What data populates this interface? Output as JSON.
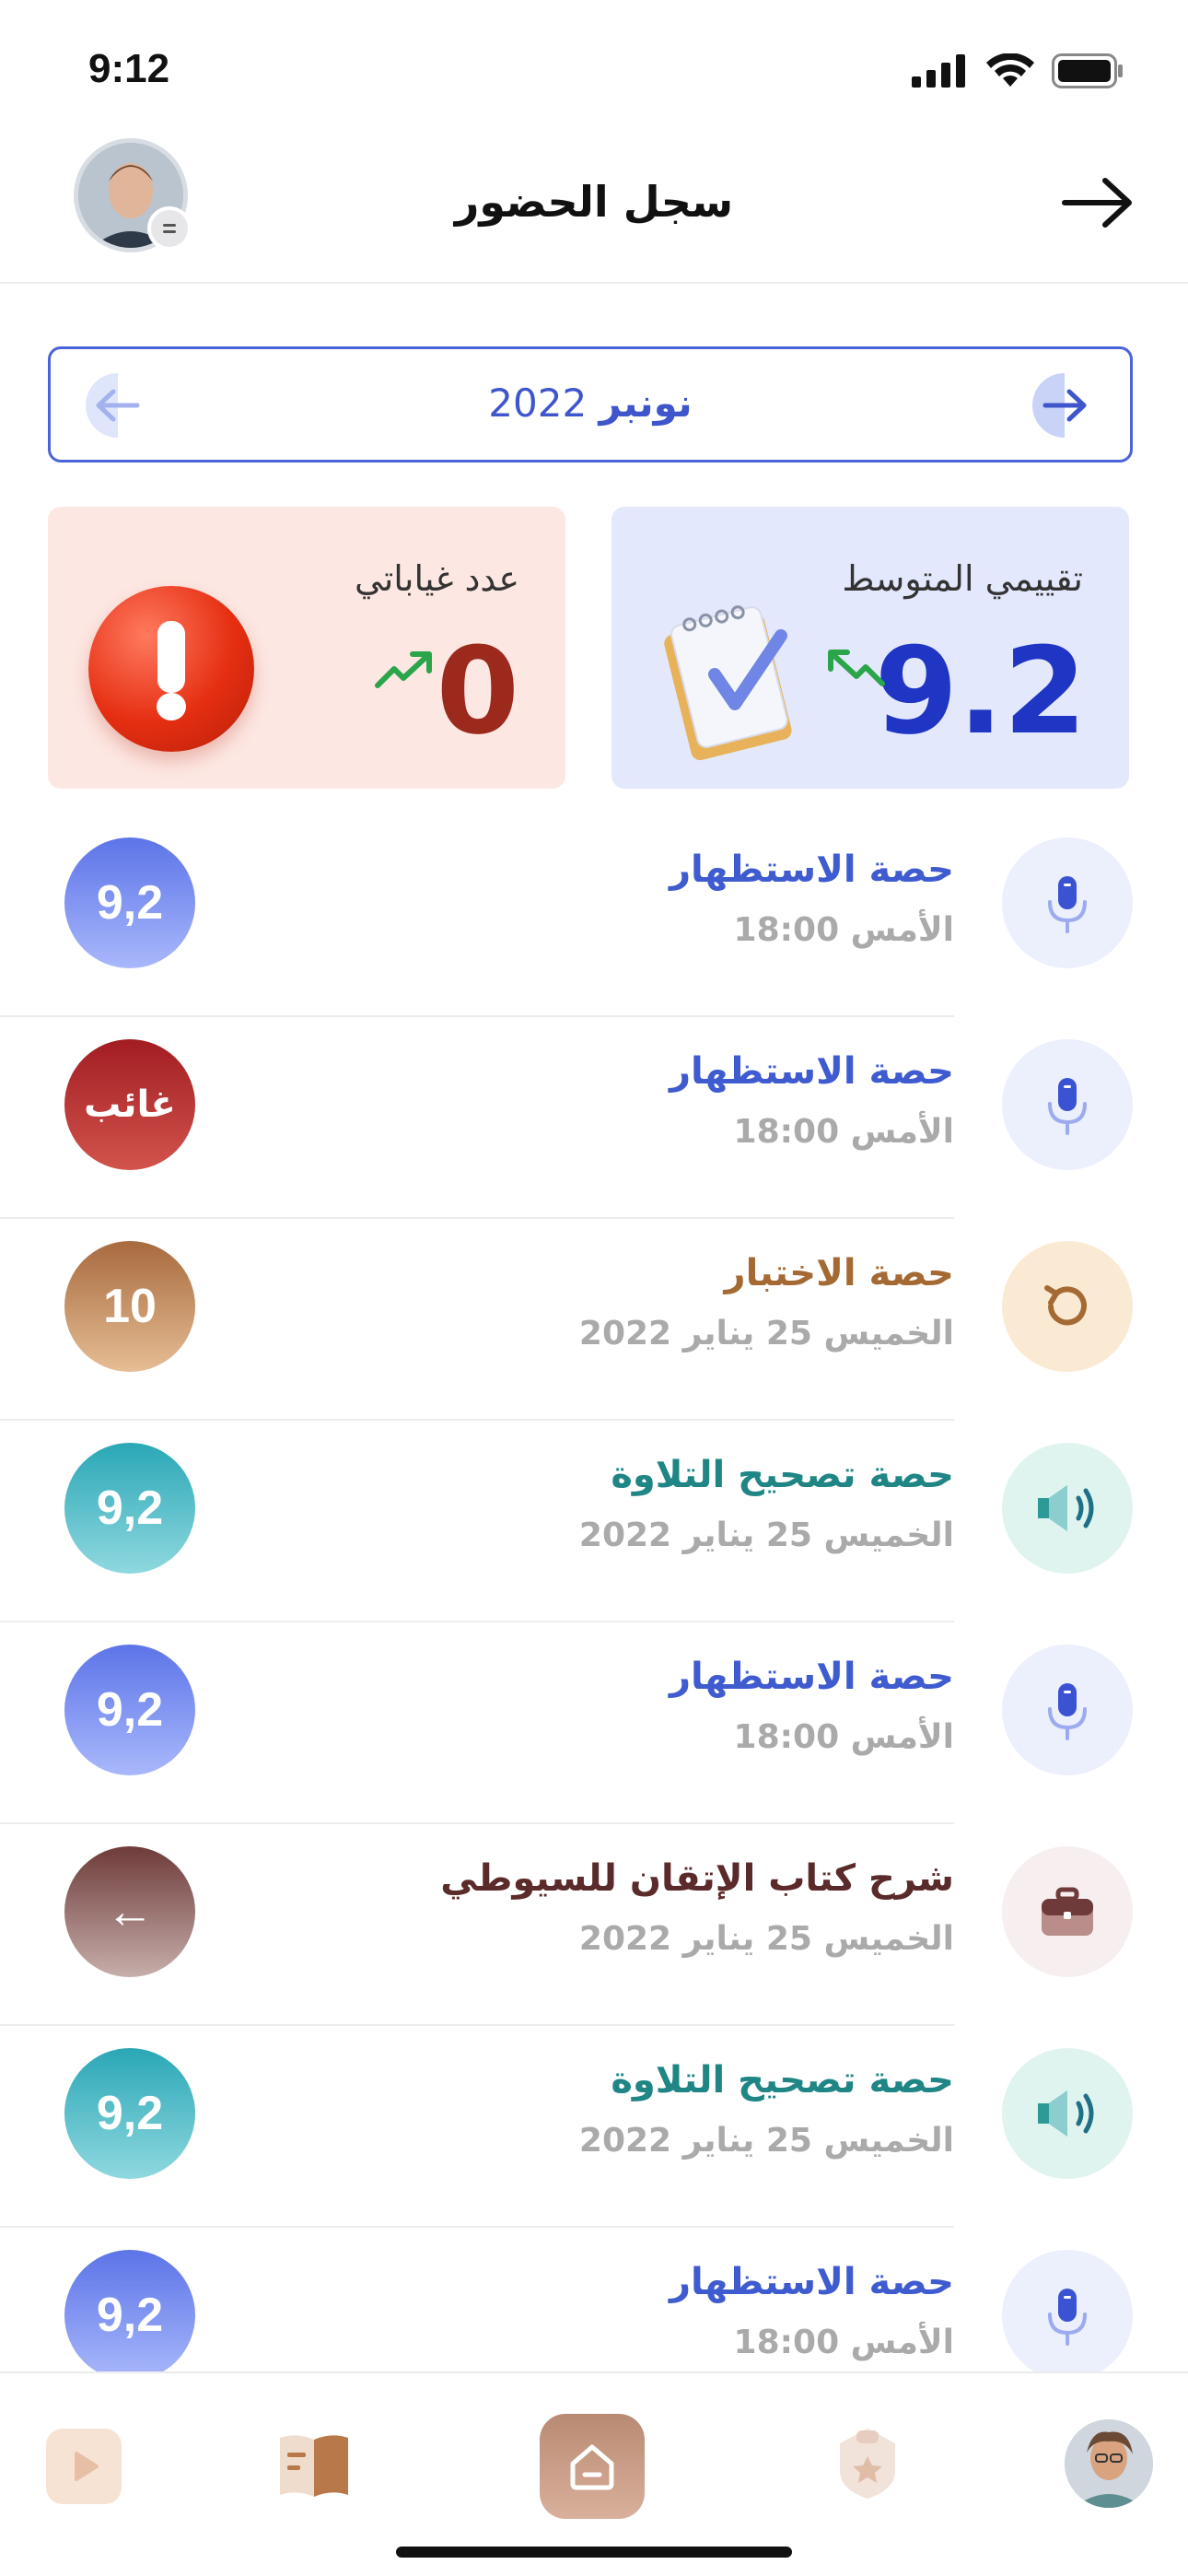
{
  "status_bar": {
    "time": "9:12"
  },
  "header": {
    "title": "سجل الحضور",
    "avatar_icon": "user-avatar",
    "back_icon": "arrow-right-icon"
  },
  "month_selector": {
    "month": "نونبر",
    "year": "2022"
  },
  "stats": {
    "average": {
      "label": "تقييمي المتوسط",
      "value": "9.2",
      "trend": "up",
      "icon": "clipboard-check-icon"
    },
    "absences": {
      "label": "عدد غياباتي",
      "value": "0",
      "trend": "up",
      "icon": "alert-icon"
    }
  },
  "sessions": [
    {
      "title": "حصة الاستظهار",
      "subtitle": "الأمس 18:00",
      "score": "9,2",
      "icon": "microphone-icon",
      "theme": "blue"
    },
    {
      "title": "حصة الاستظهار",
      "subtitle": "الأمس 18:00",
      "score": "غائب",
      "icon": "microphone-icon",
      "theme": "blue",
      "badge_theme": "red"
    },
    {
      "title": "حصة الاختبار",
      "subtitle": "الخميس 25 يناير 2022",
      "score": "10",
      "icon": "refresh-icon",
      "theme": "orange"
    },
    {
      "title": "حصة تصحيح التلاوة",
      "subtitle": "الخميس 25 يناير 2022",
      "score": "9,2",
      "icon": "speaker-icon",
      "theme": "teal"
    },
    {
      "title": "حصة الاستظهار",
      "subtitle": "الأمس 18:00",
      "score": "9,2",
      "icon": "microphone-icon",
      "theme": "blue"
    },
    {
      "title": "شرح كتاب الإتقان للسيوطي",
      "subtitle": "الخميس 25 يناير 2022",
      "score": "←",
      "icon": "briefcase-icon",
      "theme": "brown"
    },
    {
      "title": "حصة تصحيح التلاوة",
      "subtitle": "الخميس 25 يناير 2022",
      "score": "9,2",
      "icon": "speaker-icon",
      "theme": "teal"
    },
    {
      "title": "حصة الاستظهار",
      "subtitle": "الأمس 18:00",
      "score": "9,2",
      "icon": "microphone-icon",
      "theme": "blue"
    }
  ],
  "tab_bar": {
    "tabs": [
      "play-icon",
      "book-icon",
      "home-icon",
      "badge-icon",
      "profile-avatar"
    ]
  }
}
